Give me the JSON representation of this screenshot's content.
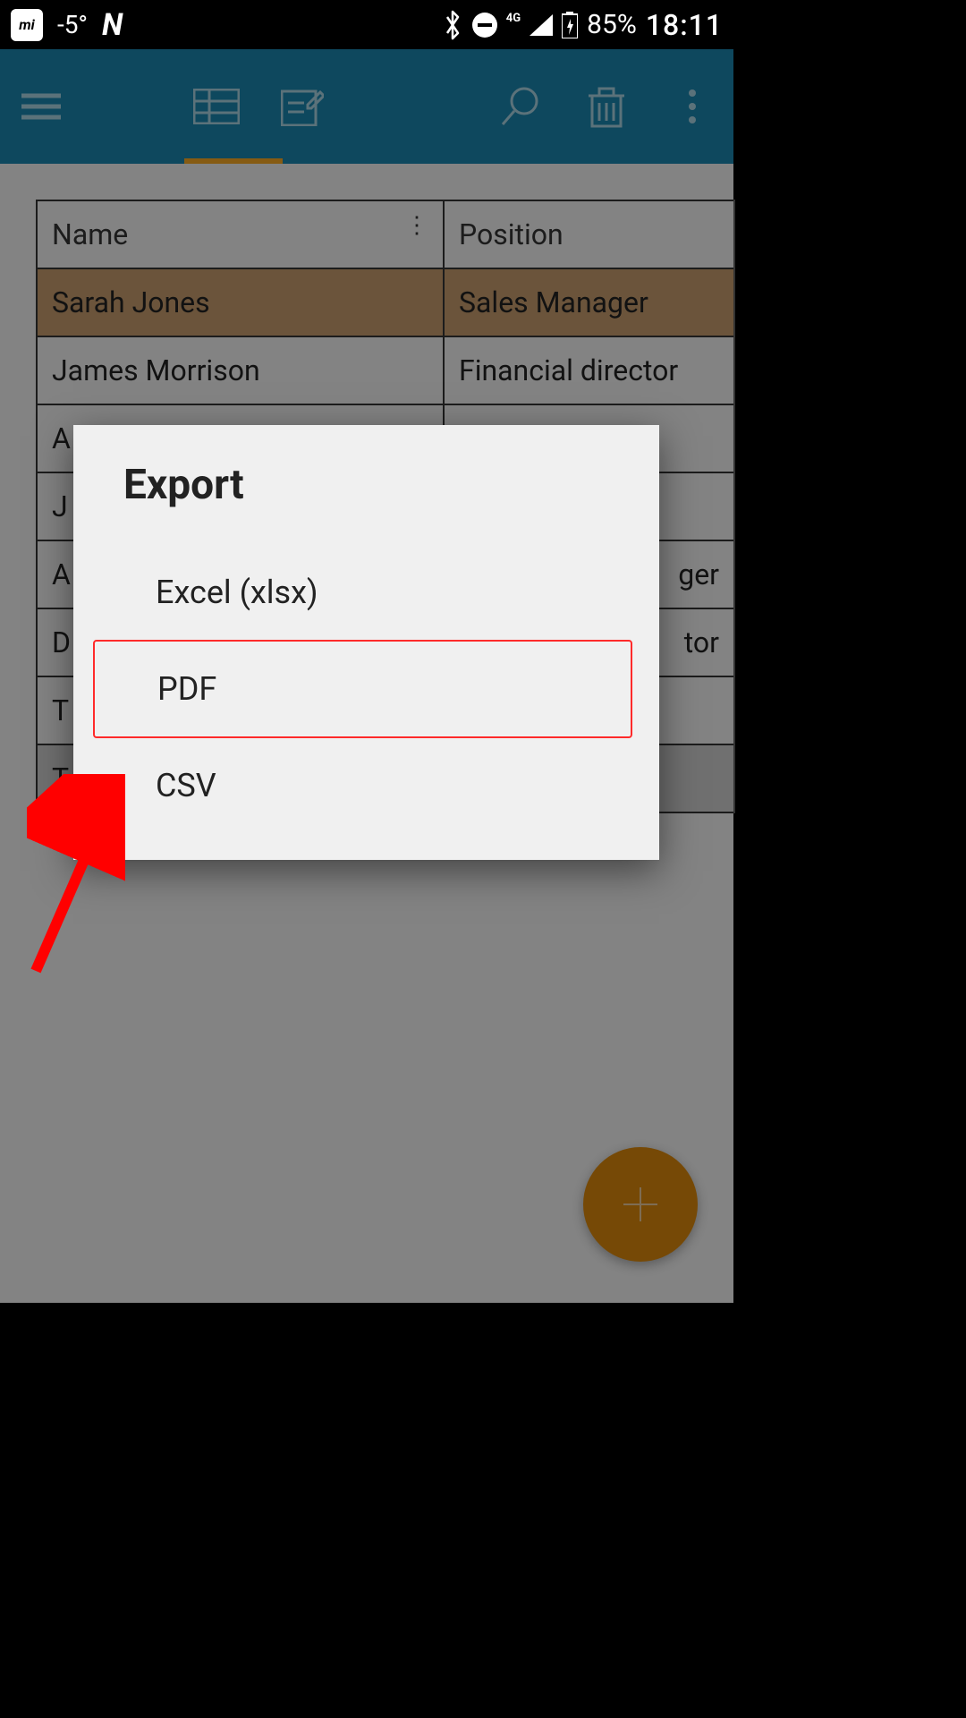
{
  "status": {
    "temperature": "-5°",
    "network_label": "4G",
    "battery": "85%",
    "time": "18:11"
  },
  "table": {
    "header_name": "Name",
    "header_position": "Position",
    "rows": [
      {
        "name": "Sarah Jones",
        "position": "Sales Manager"
      },
      {
        "name": "James Morrison",
        "position": "Financial director"
      },
      {
        "name": "A",
        "position": ""
      },
      {
        "name": "J",
        "position": ""
      },
      {
        "name": "A",
        "position": "ger"
      },
      {
        "name": "D",
        "position": "tor"
      },
      {
        "name": "T",
        "position": ""
      }
    ],
    "footer_name": "T",
    "footer_position": ""
  },
  "dialog": {
    "title": "Export",
    "option_excel": "Excel (xlsx)",
    "option_pdf": "PDF",
    "option_csv": "CSV"
  }
}
